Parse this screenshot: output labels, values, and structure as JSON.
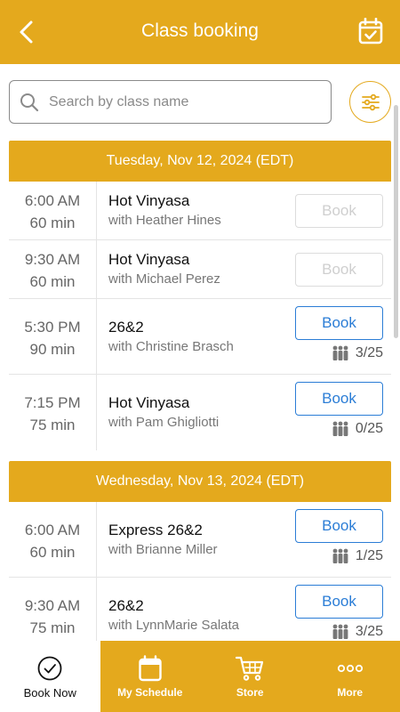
{
  "header": {
    "title": "Class booking"
  },
  "search": {
    "placeholder": "Search by class name"
  },
  "days": [
    {
      "label": "Tuesday, Nov 12, 2024 (EDT)",
      "classes": [
        {
          "time": "6:00  AM",
          "duration": "60 min",
          "name": "Hot Vinyasa",
          "instructor": "with Heather Hines",
          "book_label": "Book",
          "book_state": "disabled",
          "spots": ""
        },
        {
          "time": "9:30  AM",
          "duration": "60 min",
          "name": "Hot Vinyasa",
          "instructor": "with Michael Perez",
          "book_label": "Book",
          "book_state": "disabled",
          "spots": ""
        },
        {
          "time": "5:30  PM",
          "duration": "90 min",
          "name": "26&2",
          "instructor": "with Christine Brasch",
          "book_label": "Book",
          "book_state": "active",
          "spots": "3/25"
        },
        {
          "time": "7:15  PM",
          "duration": "75 min",
          "name": "Hot Vinyasa",
          "instructor": "with Pam Ghigliotti",
          "book_label": "Book",
          "book_state": "active",
          "spots": "0/25"
        }
      ]
    },
    {
      "label": "Wednesday, Nov 13, 2024 (EDT)",
      "classes": [
        {
          "time": "6:00  AM",
          "duration": "60 min",
          "name": "Express 26&2",
          "instructor": "with Brianne Miller",
          "book_label": "Book",
          "book_state": "active",
          "spots": "1/25"
        },
        {
          "time": "9:30  AM",
          "duration": "75 min",
          "name": "26&2",
          "instructor": "with LynnMarie Salata",
          "book_label": "Book",
          "book_state": "active",
          "spots": "3/25"
        }
      ]
    }
  ],
  "nav": {
    "book_now": "Book Now",
    "my_schedule": "My Schedule",
    "store": "Store",
    "more": "More"
  },
  "colors": {
    "brand": "#E4A91D",
    "link": "#2b7dd6"
  }
}
